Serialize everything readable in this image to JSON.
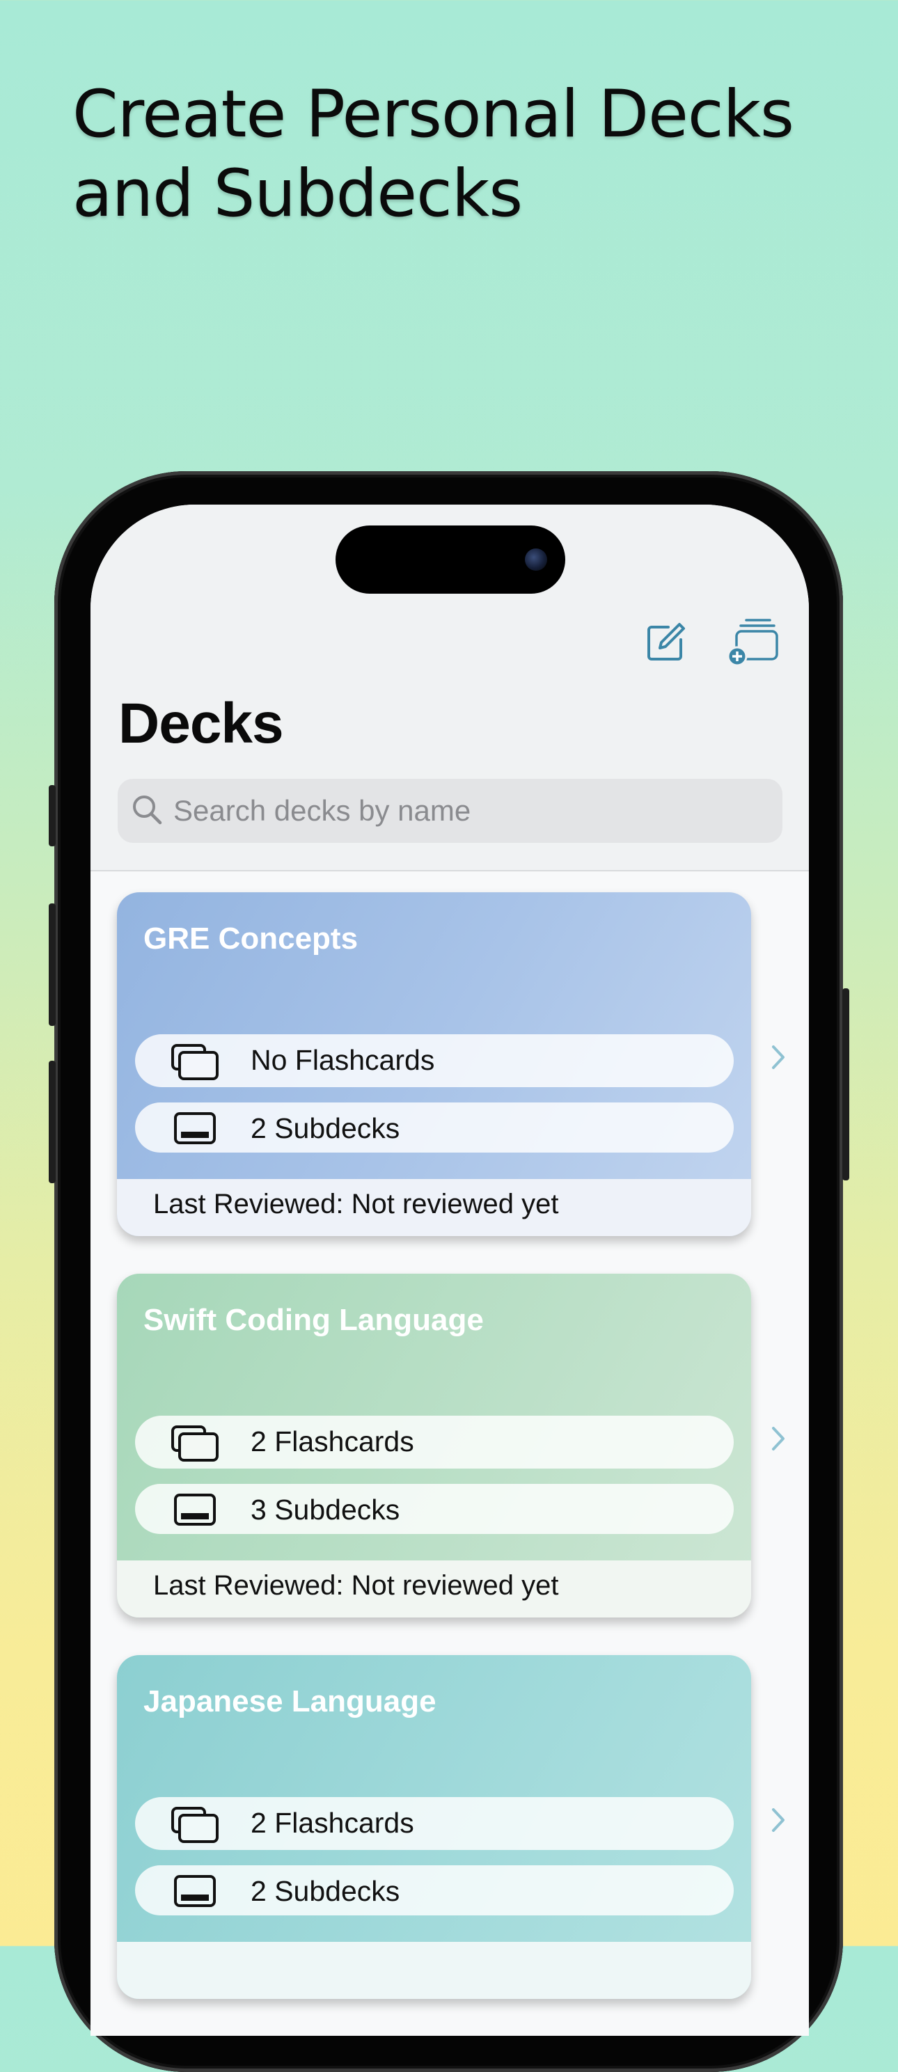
{
  "headline": {
    "line1": "Create Personal Decks",
    "line2": "and Subdecks"
  },
  "nav": {
    "title": "Decks",
    "edit_icon": "square-pencil-icon",
    "add_deck_icon": "stacked-cards-plus-icon"
  },
  "search": {
    "placeholder": "Search decks by name"
  },
  "decks": [
    {
      "title": "GRE Concepts",
      "flashcards": "No Flashcards",
      "subdecks": "2 Subdecks",
      "last_reviewed": "Last Reviewed: Not reviewed yet",
      "colors": {
        "from": "#93b4e0",
        "to": "#c2d5ef",
        "footer": "#eef2f9"
      }
    },
    {
      "title": "Swift Coding Language",
      "flashcards": "2 Flashcards",
      "subdecks": "3 Subdecks",
      "last_reviewed": "Last Reviewed: Not reviewed yet",
      "colors": {
        "from": "#a6d7b9",
        "to": "#cde6d4",
        "footer": "#f1f6f2"
      }
    },
    {
      "title": "Japanese Language",
      "flashcards": "2 Flashcards",
      "subdecks": "2 Subdecks",
      "last_reviewed": "",
      "colors": {
        "from": "#8ccfd1",
        "to": "#b3e2e1",
        "footer": "#eef7f7"
      }
    }
  ],
  "accent": "#3b86a7",
  "chevron_color": "#8fc2d2"
}
